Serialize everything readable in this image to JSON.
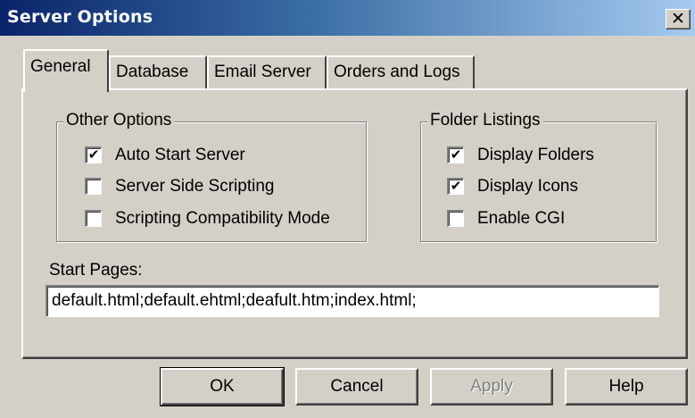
{
  "window": {
    "title": "Server Options",
    "close_glyph": "✕"
  },
  "tabs": [
    {
      "label": "General",
      "active": true
    },
    {
      "label": "Database",
      "active": false
    },
    {
      "label": "Email Server",
      "active": false
    },
    {
      "label": "Orders and Logs",
      "active": false
    }
  ],
  "other_options": {
    "legend": "Other Options",
    "items": [
      {
        "label": "Auto Start Server",
        "checked": true,
        "mark": "✔"
      },
      {
        "label": "Server Side Scripting",
        "checked": false,
        "mark": ""
      },
      {
        "label": "Scripting Compatibility Mode",
        "checked": false,
        "mark": ""
      }
    ]
  },
  "folder_listings": {
    "legend": "Folder Listings",
    "items": [
      {
        "label": "Display Folders",
        "checked": true,
        "mark": "✔"
      },
      {
        "label": "Display Icons",
        "checked": true,
        "mark": "✔"
      },
      {
        "label": "Enable CGI",
        "checked": false,
        "mark": ""
      }
    ]
  },
  "start_pages": {
    "label": "Start Pages:",
    "value": "default.html;default.ehtml;deafult.htm;index.html;"
  },
  "buttons": {
    "ok": "OK",
    "cancel": "Cancel",
    "apply": "Apply",
    "help": "Help"
  },
  "colors": {
    "face": "#d4d0c8",
    "title_gradient_start": "#0a246a",
    "title_gradient_end": "#a6caf0",
    "disabled_text": "#808080"
  }
}
